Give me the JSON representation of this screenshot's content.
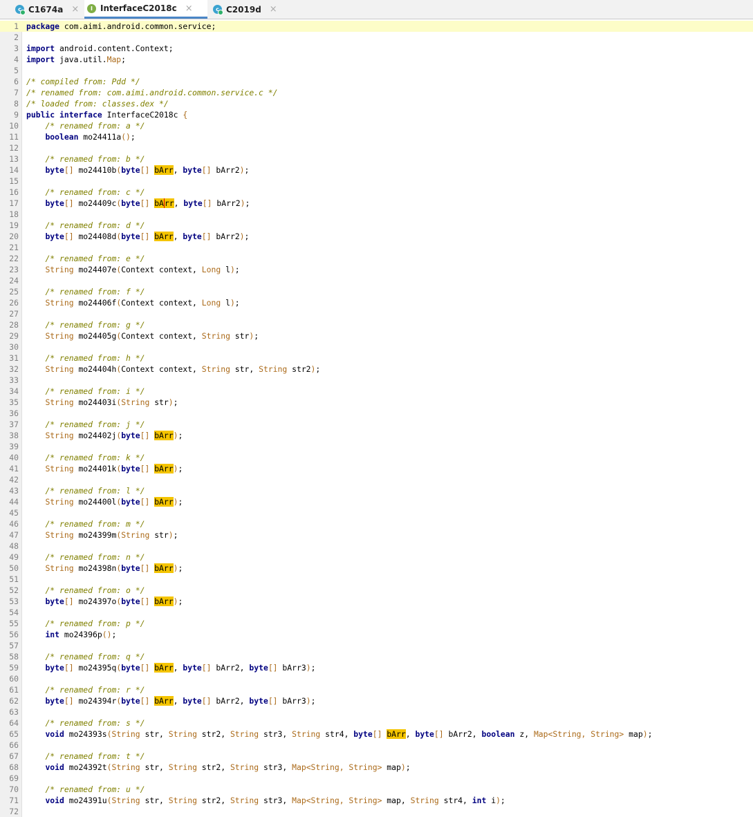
{
  "tabs": [
    {
      "label": "C1674a",
      "icon": "class-icon",
      "icon_letter": "c",
      "active": false
    },
    {
      "label": "InterfaceC2018c",
      "icon": "interface-icon",
      "icon_letter": "I",
      "active": true
    },
    {
      "label": "C2019d",
      "icon": "class-icon",
      "icon_letter": "c",
      "active": false
    }
  ],
  "tab_close_glyph": "×",
  "colors": {
    "keyword": "#000080",
    "comment": "#808000",
    "class_name": "#ab6a19",
    "highlight": "#f4c400",
    "current_line": "#fdfdc8",
    "active_tab_underline": "#4a86c7"
  },
  "current_line": 1,
  "caret_line": 17,
  "lines": [
    [
      [
        "kw",
        "package"
      ],
      [
        "t",
        " com.aimi.android.common.service;"
      ]
    ],
    [],
    [
      [
        "kw",
        "import"
      ],
      [
        "t",
        " android.content.Context;"
      ]
    ],
    [
      [
        "kw",
        "import"
      ],
      [
        "t",
        " java.util."
      ],
      [
        "cls",
        "Map"
      ],
      [
        "t",
        ";"
      ]
    ],
    [],
    [
      [
        "cm",
        "/* compiled from: Pdd */"
      ]
    ],
    [
      [
        "cm",
        "/* renamed from: com.aimi.android.common.service.c */"
      ]
    ],
    [
      [
        "cm",
        "/* loaded from: classes.dex */"
      ]
    ],
    [
      [
        "kw",
        "public"
      ],
      [
        "t",
        " "
      ],
      [
        "kw",
        "interface"
      ],
      [
        "t",
        " InterfaceC2018c "
      ],
      [
        "cls",
        "{"
      ]
    ],
    [
      [
        "t",
        "    "
      ],
      [
        "cm",
        "/* renamed from: a */"
      ]
    ],
    [
      [
        "t",
        "    "
      ],
      [
        "ty",
        "boolean"
      ],
      [
        "t",
        " mo24411a"
      ],
      [
        "cls",
        "()"
      ],
      [
        "t",
        ";"
      ]
    ],
    [],
    [
      [
        "t",
        "    "
      ],
      [
        "cm",
        "/* renamed from: b */"
      ]
    ],
    [
      [
        "t",
        "    "
      ],
      [
        "ty",
        "byte"
      ],
      [
        "cls",
        "[]"
      ],
      [
        "t",
        " mo24410b"
      ],
      [
        "cls",
        "("
      ],
      [
        "ty",
        "byte"
      ],
      [
        "cls",
        "[]"
      ],
      [
        "t",
        " "
      ],
      [
        "hl",
        "bArr"
      ],
      [
        "t",
        ", "
      ],
      [
        "ty",
        "byte"
      ],
      [
        "cls",
        "[]"
      ],
      [
        "t",
        " bArr2"
      ],
      [
        "cls",
        ")"
      ],
      [
        "t",
        ";"
      ]
    ],
    [],
    [
      [
        "t",
        "    "
      ],
      [
        "cm",
        "/* renamed from: c */"
      ]
    ],
    [
      [
        "t",
        "    "
      ],
      [
        "ty",
        "byte"
      ],
      [
        "cls",
        "[]"
      ],
      [
        "t",
        " mo24409c"
      ],
      [
        "cls",
        "("
      ],
      [
        "ty",
        "byte"
      ],
      [
        "cls",
        "[]"
      ],
      [
        "t",
        " "
      ],
      [
        "hl",
        "bA"
      ],
      [
        "hlc",
        "rr"
      ],
      [
        "t",
        ", "
      ],
      [
        "ty",
        "byte"
      ],
      [
        "cls",
        "[]"
      ],
      [
        "t",
        " bArr2"
      ],
      [
        "cls",
        ")"
      ],
      [
        "t",
        ";"
      ]
    ],
    [],
    [
      [
        "t",
        "    "
      ],
      [
        "cm",
        "/* renamed from: d */"
      ]
    ],
    [
      [
        "t",
        "    "
      ],
      [
        "ty",
        "byte"
      ],
      [
        "cls",
        "[]"
      ],
      [
        "t",
        " mo24408d"
      ],
      [
        "cls",
        "("
      ],
      [
        "ty",
        "byte"
      ],
      [
        "cls",
        "[]"
      ],
      [
        "t",
        " "
      ],
      [
        "hl",
        "bArr"
      ],
      [
        "t",
        ", "
      ],
      [
        "ty",
        "byte"
      ],
      [
        "cls",
        "[]"
      ],
      [
        "t",
        " bArr2"
      ],
      [
        "cls",
        ")"
      ],
      [
        "t",
        ";"
      ]
    ],
    [],
    [
      [
        "t",
        "    "
      ],
      [
        "cm",
        "/* renamed from: e */"
      ]
    ],
    [
      [
        "t",
        "    "
      ],
      [
        "cls",
        "String"
      ],
      [
        "t",
        " mo24407e"
      ],
      [
        "cls",
        "("
      ],
      [
        "t",
        "Context context, "
      ],
      [
        "cls",
        "Long"
      ],
      [
        "t",
        " l"
      ],
      [
        "cls",
        ")"
      ],
      [
        "t",
        ";"
      ]
    ],
    [],
    [
      [
        "t",
        "    "
      ],
      [
        "cm",
        "/* renamed from: f */"
      ]
    ],
    [
      [
        "t",
        "    "
      ],
      [
        "cls",
        "String"
      ],
      [
        "t",
        " mo24406f"
      ],
      [
        "cls",
        "("
      ],
      [
        "t",
        "Context context, "
      ],
      [
        "cls",
        "Long"
      ],
      [
        "t",
        " l"
      ],
      [
        "cls",
        ")"
      ],
      [
        "t",
        ";"
      ]
    ],
    [],
    [
      [
        "t",
        "    "
      ],
      [
        "cm",
        "/* renamed from: g */"
      ]
    ],
    [
      [
        "t",
        "    "
      ],
      [
        "cls",
        "String"
      ],
      [
        "t",
        " mo24405g"
      ],
      [
        "cls",
        "("
      ],
      [
        "t",
        "Context context, "
      ],
      [
        "cls",
        "String"
      ],
      [
        "t",
        " str"
      ],
      [
        "cls",
        ")"
      ],
      [
        "t",
        ";"
      ]
    ],
    [],
    [
      [
        "t",
        "    "
      ],
      [
        "cm",
        "/* renamed from: h */"
      ]
    ],
    [
      [
        "t",
        "    "
      ],
      [
        "cls",
        "String"
      ],
      [
        "t",
        " mo24404h"
      ],
      [
        "cls",
        "("
      ],
      [
        "t",
        "Context context, "
      ],
      [
        "cls",
        "String"
      ],
      [
        "t",
        " str, "
      ],
      [
        "cls",
        "String"
      ],
      [
        "t",
        " str2"
      ],
      [
        "cls",
        ")"
      ],
      [
        "t",
        ";"
      ]
    ],
    [],
    [
      [
        "t",
        "    "
      ],
      [
        "cm",
        "/* renamed from: i */"
      ]
    ],
    [
      [
        "t",
        "    "
      ],
      [
        "cls",
        "String"
      ],
      [
        "t",
        " mo24403i"
      ],
      [
        "cls",
        "("
      ],
      [
        "cls",
        "String"
      ],
      [
        "t",
        " str"
      ],
      [
        "cls",
        ")"
      ],
      [
        "t",
        ";"
      ]
    ],
    [],
    [
      [
        "t",
        "    "
      ],
      [
        "cm",
        "/* renamed from: j */"
      ]
    ],
    [
      [
        "t",
        "    "
      ],
      [
        "cls",
        "String"
      ],
      [
        "t",
        " mo24402j"
      ],
      [
        "cls",
        "("
      ],
      [
        "ty",
        "byte"
      ],
      [
        "cls",
        "[]"
      ],
      [
        "t",
        " "
      ],
      [
        "hl",
        "bArr"
      ],
      [
        "cls",
        ")"
      ],
      [
        "t",
        ";"
      ]
    ],
    [],
    [
      [
        "t",
        "    "
      ],
      [
        "cm",
        "/* renamed from: k */"
      ]
    ],
    [
      [
        "t",
        "    "
      ],
      [
        "cls",
        "String"
      ],
      [
        "t",
        " mo24401k"
      ],
      [
        "cls",
        "("
      ],
      [
        "ty",
        "byte"
      ],
      [
        "cls",
        "[]"
      ],
      [
        "t",
        " "
      ],
      [
        "hl",
        "bArr"
      ],
      [
        "cls",
        ")"
      ],
      [
        "t",
        ";"
      ]
    ],
    [],
    [
      [
        "t",
        "    "
      ],
      [
        "cm",
        "/* renamed from: l */"
      ]
    ],
    [
      [
        "t",
        "    "
      ],
      [
        "cls",
        "String"
      ],
      [
        "t",
        " mo24400l"
      ],
      [
        "cls",
        "("
      ],
      [
        "ty",
        "byte"
      ],
      [
        "cls",
        "[]"
      ],
      [
        "t",
        " "
      ],
      [
        "hl",
        "bArr"
      ],
      [
        "cls",
        ")"
      ],
      [
        "t",
        ";"
      ]
    ],
    [],
    [
      [
        "t",
        "    "
      ],
      [
        "cm",
        "/* renamed from: m */"
      ]
    ],
    [
      [
        "t",
        "    "
      ],
      [
        "cls",
        "String"
      ],
      [
        "t",
        " mo24399m"
      ],
      [
        "cls",
        "("
      ],
      [
        "cls",
        "String"
      ],
      [
        "t",
        " str"
      ],
      [
        "cls",
        ")"
      ],
      [
        "t",
        ";"
      ]
    ],
    [],
    [
      [
        "t",
        "    "
      ],
      [
        "cm",
        "/* renamed from: n */"
      ]
    ],
    [
      [
        "t",
        "    "
      ],
      [
        "cls",
        "String"
      ],
      [
        "t",
        " mo24398n"
      ],
      [
        "cls",
        "("
      ],
      [
        "ty",
        "byte"
      ],
      [
        "cls",
        "[]"
      ],
      [
        "t",
        " "
      ],
      [
        "hl",
        "bArr"
      ],
      [
        "cls",
        ")"
      ],
      [
        "t",
        ";"
      ]
    ],
    [],
    [
      [
        "t",
        "    "
      ],
      [
        "cm",
        "/* renamed from: o */"
      ]
    ],
    [
      [
        "t",
        "    "
      ],
      [
        "ty",
        "byte"
      ],
      [
        "cls",
        "[]"
      ],
      [
        "t",
        " mo24397o"
      ],
      [
        "cls",
        "("
      ],
      [
        "ty",
        "byte"
      ],
      [
        "cls",
        "[]"
      ],
      [
        "t",
        " "
      ],
      [
        "hl",
        "bArr"
      ],
      [
        "cls",
        ")"
      ],
      [
        "t",
        ";"
      ]
    ],
    [],
    [
      [
        "t",
        "    "
      ],
      [
        "cm",
        "/* renamed from: p */"
      ]
    ],
    [
      [
        "t",
        "    "
      ],
      [
        "ty",
        "int"
      ],
      [
        "t",
        " mo24396p"
      ],
      [
        "cls",
        "()"
      ],
      [
        "t",
        ";"
      ]
    ],
    [],
    [
      [
        "t",
        "    "
      ],
      [
        "cm",
        "/* renamed from: q */"
      ]
    ],
    [
      [
        "t",
        "    "
      ],
      [
        "ty",
        "byte"
      ],
      [
        "cls",
        "[]"
      ],
      [
        "t",
        " mo24395q"
      ],
      [
        "cls",
        "("
      ],
      [
        "ty",
        "byte"
      ],
      [
        "cls",
        "[]"
      ],
      [
        "t",
        " "
      ],
      [
        "hl",
        "bArr"
      ],
      [
        "t",
        ", "
      ],
      [
        "ty",
        "byte"
      ],
      [
        "cls",
        "[]"
      ],
      [
        "t",
        " bArr2, "
      ],
      [
        "ty",
        "byte"
      ],
      [
        "cls",
        "[]"
      ],
      [
        "t",
        " bArr3"
      ],
      [
        "cls",
        ")"
      ],
      [
        "t",
        ";"
      ]
    ],
    [],
    [
      [
        "t",
        "    "
      ],
      [
        "cm",
        "/* renamed from: r */"
      ]
    ],
    [
      [
        "t",
        "    "
      ],
      [
        "ty",
        "byte"
      ],
      [
        "cls",
        "[]"
      ],
      [
        "t",
        " mo24394r"
      ],
      [
        "cls",
        "("
      ],
      [
        "ty",
        "byte"
      ],
      [
        "cls",
        "[]"
      ],
      [
        "t",
        " "
      ],
      [
        "hl",
        "bArr"
      ],
      [
        "t",
        ", "
      ],
      [
        "ty",
        "byte"
      ],
      [
        "cls",
        "[]"
      ],
      [
        "t",
        " bArr2, "
      ],
      [
        "ty",
        "byte"
      ],
      [
        "cls",
        "[]"
      ],
      [
        "t",
        " bArr3"
      ],
      [
        "cls",
        ")"
      ],
      [
        "t",
        ";"
      ]
    ],
    [],
    [
      [
        "t",
        "    "
      ],
      [
        "cm",
        "/* renamed from: s */"
      ]
    ],
    [
      [
        "t",
        "    "
      ],
      [
        "ty",
        "void"
      ],
      [
        "t",
        " mo24393s"
      ],
      [
        "cls",
        "("
      ],
      [
        "cls",
        "String"
      ],
      [
        "t",
        " str, "
      ],
      [
        "cls",
        "String"
      ],
      [
        "t",
        " str2, "
      ],
      [
        "cls",
        "String"
      ],
      [
        "t",
        " str3, "
      ],
      [
        "cls",
        "String"
      ],
      [
        "t",
        " str4, "
      ],
      [
        "ty",
        "byte"
      ],
      [
        "cls",
        "[]"
      ],
      [
        "t",
        " "
      ],
      [
        "hl",
        "bArr"
      ],
      [
        "t",
        ", "
      ],
      [
        "ty",
        "byte"
      ],
      [
        "cls",
        "[]"
      ],
      [
        "t",
        " bArr2, "
      ],
      [
        "ty",
        "boolean"
      ],
      [
        "t",
        " z, "
      ],
      [
        "cls",
        "Map<String, String>"
      ],
      [
        "t",
        " map"
      ],
      [
        "cls",
        ")"
      ],
      [
        "t",
        ";"
      ]
    ],
    [],
    [
      [
        "t",
        "    "
      ],
      [
        "cm",
        "/* renamed from: t */"
      ]
    ],
    [
      [
        "t",
        "    "
      ],
      [
        "ty",
        "void"
      ],
      [
        "t",
        " mo24392t"
      ],
      [
        "cls",
        "("
      ],
      [
        "cls",
        "String"
      ],
      [
        "t",
        " str, "
      ],
      [
        "cls",
        "String"
      ],
      [
        "t",
        " str2, "
      ],
      [
        "cls",
        "String"
      ],
      [
        "t",
        " str3, "
      ],
      [
        "cls",
        "Map<String, String>"
      ],
      [
        "t",
        " map"
      ],
      [
        "cls",
        ")"
      ],
      [
        "t",
        ";"
      ]
    ],
    [],
    [
      [
        "t",
        "    "
      ],
      [
        "cm",
        "/* renamed from: u */"
      ]
    ],
    [
      [
        "t",
        "    "
      ],
      [
        "ty",
        "void"
      ],
      [
        "t",
        " mo24391u"
      ],
      [
        "cls",
        "("
      ],
      [
        "cls",
        "String"
      ],
      [
        "t",
        " str, "
      ],
      [
        "cls",
        "String"
      ],
      [
        "t",
        " str2, "
      ],
      [
        "cls",
        "String"
      ],
      [
        "t",
        " str3, "
      ],
      [
        "cls",
        "Map<String, String>"
      ],
      [
        "t",
        " map, "
      ],
      [
        "cls",
        "String"
      ],
      [
        "t",
        " str4, "
      ],
      [
        "ty",
        "int"
      ],
      [
        "t",
        " i"
      ],
      [
        "cls",
        ")"
      ],
      [
        "t",
        ";"
      ]
    ],
    []
  ]
}
